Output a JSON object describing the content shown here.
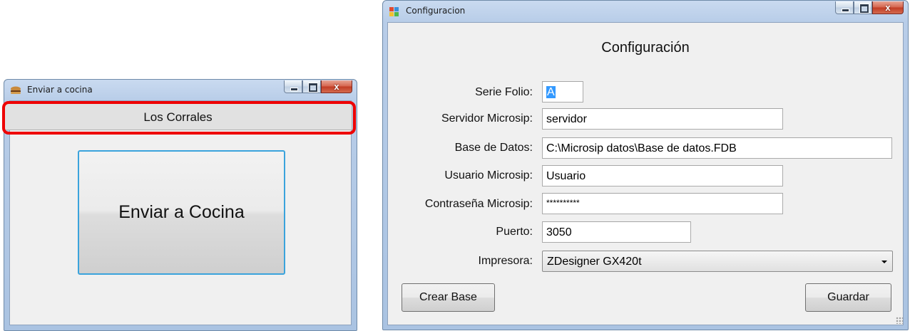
{
  "window_kitchen": {
    "title": "Enviar a cocina",
    "header_label": "Los Corrales",
    "send_button_label": "Enviar a Cocina"
  },
  "window_config": {
    "title": "Configuracion",
    "heading": "Configuración",
    "fields": {
      "serie_folio": {
        "label": "Serie Folio:",
        "value": "A"
      },
      "servidor": {
        "label": "Servidor Microsip:",
        "value": "servidor"
      },
      "base_datos": {
        "label": "Base de Datos:",
        "value": "C:\\Microsip datos\\Base de datos.FDB"
      },
      "usuario": {
        "label": "Usuario Microsip:",
        "value": "Usuario"
      },
      "contrasena": {
        "label": "Contraseña Microsip:",
        "value": "**********"
      },
      "puerto": {
        "label": "Puerto:",
        "value": "3050"
      },
      "impresora": {
        "label": "Impresora:",
        "value": "ZDesigner GX420t"
      }
    },
    "create_button_label": "Crear Base",
    "save_button_label": "Guardar"
  },
  "colors": {
    "highlight": "#ee0000",
    "focus_border": "#3aa3dc",
    "selection": "#3399ff",
    "close_button": "#c13b24"
  },
  "icons": [
    "app-icon-burger",
    "app-icon-config",
    "minimize-icon",
    "maximize-icon",
    "close-icon",
    "dropdown-arrow-icon",
    "size-grip-icon"
  ]
}
